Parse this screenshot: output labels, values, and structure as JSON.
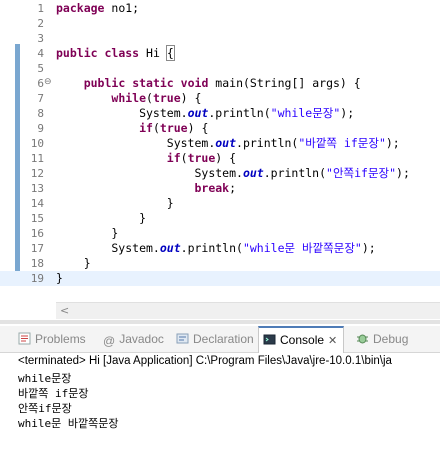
{
  "editor": {
    "lines": [
      {
        "num": "1",
        "tokens": [
          {
            "t": "kw",
            "v": "package"
          },
          {
            "t": "",
            "v": " no1;"
          }
        ]
      },
      {
        "num": "2",
        "tokens": []
      },
      {
        "num": "3",
        "tokens": []
      },
      {
        "num": "4",
        "tokens": [
          {
            "t": "kw",
            "v": "public"
          },
          {
            "t": "",
            "v": " "
          },
          {
            "t": "kw",
            "v": "class"
          },
          {
            "t": "",
            "v": " Hi "
          },
          {
            "t": "box",
            "v": "{"
          }
        ]
      },
      {
        "num": "5",
        "tokens": []
      },
      {
        "num": "6",
        "tokens": [
          {
            "t": "",
            "v": "    "
          },
          {
            "t": "kw",
            "v": "public"
          },
          {
            "t": "",
            "v": " "
          },
          {
            "t": "kw",
            "v": "static"
          },
          {
            "t": "",
            "v": " "
          },
          {
            "t": "kw",
            "v": "void"
          },
          {
            "t": "",
            "v": " main(String[] args) {"
          }
        ],
        "fold": "⊖"
      },
      {
        "num": "7",
        "tokens": [
          {
            "t": "",
            "v": "        "
          },
          {
            "t": "kw",
            "v": "while"
          },
          {
            "t": "",
            "v": "("
          },
          {
            "t": "kw",
            "v": "true"
          },
          {
            "t": "",
            "v": ") {"
          }
        ]
      },
      {
        "num": "8",
        "tokens": [
          {
            "t": "",
            "v": "            System."
          },
          {
            "t": "fld",
            "v": "out"
          },
          {
            "t": "",
            "v": ".println("
          },
          {
            "t": "str",
            "v": "\"while문장\""
          },
          {
            "t": "",
            "v": ");"
          }
        ]
      },
      {
        "num": "9",
        "tokens": [
          {
            "t": "",
            "v": "            "
          },
          {
            "t": "kw",
            "v": "if"
          },
          {
            "t": "",
            "v": "("
          },
          {
            "t": "kw",
            "v": "true"
          },
          {
            "t": "",
            "v": ") {"
          }
        ]
      },
      {
        "num": "10",
        "tokens": [
          {
            "t": "",
            "v": "                System."
          },
          {
            "t": "fld",
            "v": "out"
          },
          {
            "t": "",
            "v": ".println("
          },
          {
            "t": "str",
            "v": "\"바깥쪽 if문장\""
          },
          {
            "t": "",
            "v": ");"
          }
        ]
      },
      {
        "num": "11",
        "tokens": [
          {
            "t": "",
            "v": "                "
          },
          {
            "t": "kw",
            "v": "if"
          },
          {
            "t": "",
            "v": "("
          },
          {
            "t": "kw",
            "v": "true"
          },
          {
            "t": "",
            "v": ") {"
          }
        ]
      },
      {
        "num": "12",
        "tokens": [
          {
            "t": "",
            "v": "                    System."
          },
          {
            "t": "fld",
            "v": "out"
          },
          {
            "t": "",
            "v": ".println("
          },
          {
            "t": "str",
            "v": "\"안쪽if문장\""
          },
          {
            "t": "",
            "v": ");"
          }
        ]
      },
      {
        "num": "13",
        "tokens": [
          {
            "t": "",
            "v": "                    "
          },
          {
            "t": "kw",
            "v": "break"
          },
          {
            "t": "",
            "v": ";"
          }
        ]
      },
      {
        "num": "14",
        "tokens": [
          {
            "t": "",
            "v": "                }"
          }
        ]
      },
      {
        "num": "15",
        "tokens": [
          {
            "t": "",
            "v": "            }"
          }
        ]
      },
      {
        "num": "16",
        "tokens": [
          {
            "t": "",
            "v": "        }"
          }
        ]
      },
      {
        "num": "17",
        "tokens": [
          {
            "t": "",
            "v": "        System."
          },
          {
            "t": "fld",
            "v": "out"
          },
          {
            "t": "",
            "v": ".println("
          },
          {
            "t": "str",
            "v": "\"while문 바깥쪽문장\""
          },
          {
            "t": "",
            "v": ");"
          }
        ]
      },
      {
        "num": "18",
        "tokens": [
          {
            "t": "",
            "v": "    }"
          }
        ]
      },
      {
        "num": "19",
        "tokens": [
          {
            "t": "",
            "v": "}"
          }
        ],
        "current": true
      }
    ]
  },
  "tabs": [
    {
      "label": "Problems",
      "icon": "problems-icon",
      "active": false
    },
    {
      "label": "Javadoc",
      "icon": "javadoc-icon",
      "active": false
    },
    {
      "label": "Declaration",
      "icon": "declaration-icon",
      "active": false
    },
    {
      "label": "Console",
      "icon": "console-icon",
      "active": true,
      "close": "✕"
    },
    {
      "label": "Debug",
      "icon": "debug-icon",
      "active": false
    }
  ],
  "console": {
    "header": "<terminated> Hi [Java Application] C:\\Program Files\\Java\\jre-10.0.1\\bin\\ja",
    "output": [
      "while문장",
      "바깥쪽 if문장",
      "안쪽if문장",
      "while문 바깥쪽문장"
    ]
  }
}
